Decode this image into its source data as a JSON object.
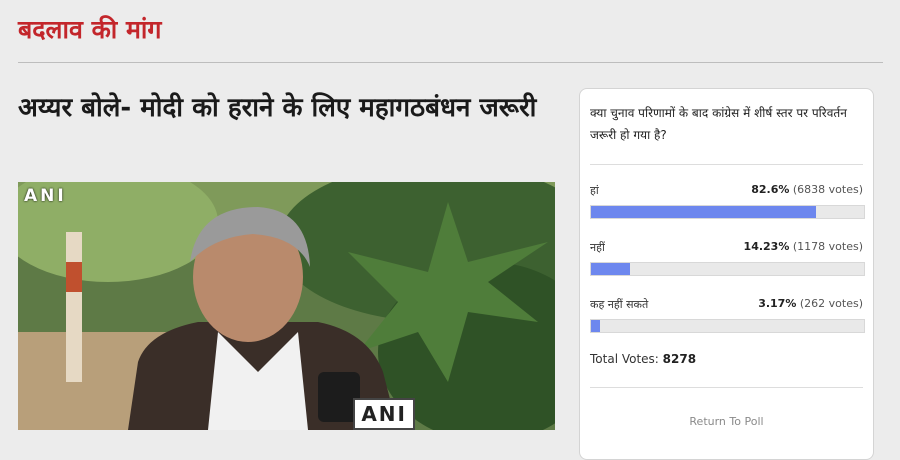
{
  "section": {
    "title": "बदलाव की मांग"
  },
  "article": {
    "headline": "अय्यर बोले- मोदी को हराने के लिए महागठबंधन जरूरी",
    "photo": {
      "watermark_top": "ANI",
      "mic_logo": "ANI"
    }
  },
  "poll": {
    "question": "क्या चुनाव परिणामों के बाद कांग्रेस में शीर्ष स्तर पर परिवर्तन जरूरी हो गया है?",
    "options": [
      {
        "label": "हां",
        "percent_text": "82.6%",
        "votes_text": "(6838 votes)",
        "percent": 82.6
      },
      {
        "label": "नहीं",
        "percent_text": "14.23%",
        "votes_text": "(1178 votes)",
        "percent": 14.23
      },
      {
        "label": "कह नहीं सकते",
        "percent_text": "3.17%",
        "votes_text": "(262 votes)",
        "percent": 3.17
      }
    ],
    "total_label": "Total Votes:",
    "total_value": "8278",
    "return_label": "Return To Poll"
  },
  "colors": {
    "accent_red": "#c3262b",
    "bar_fill": "#6d87ee"
  }
}
